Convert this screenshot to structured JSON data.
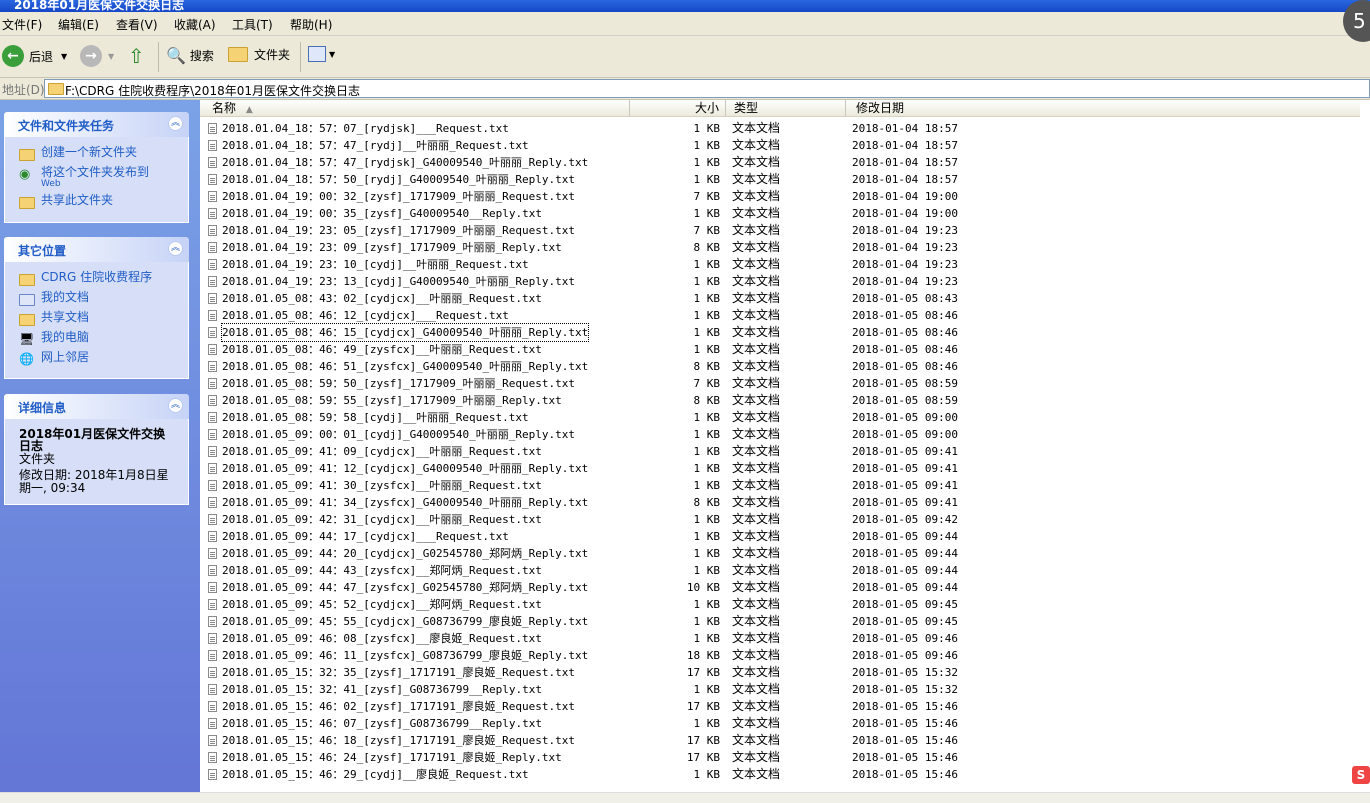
{
  "window": {
    "title": "2018年01月医保文件交换日志"
  },
  "menu": [
    "文件(F)",
    "编辑(E)",
    "查看(V)",
    "收藏(A)",
    "工具(T)",
    "帮助(H)"
  ],
  "toolbar": {
    "back": "后退",
    "search": "搜索",
    "folders": "文件夹"
  },
  "address": {
    "label": "地址(D)",
    "path": "F:\\CDRG 住院收费程序\\2018年01月医保文件交换日志"
  },
  "tasks": {
    "title": "文件和文件夹任务",
    "items": [
      "创建一个新文件夹",
      "将这个文件夹发布到",
      "Web",
      "共享此文件夹"
    ]
  },
  "places": {
    "title": "其它位置",
    "items": [
      "CDRG 住院收费程序",
      "我的文档",
      "共享文档",
      "我的电脑",
      "网上邻居"
    ]
  },
  "details": {
    "title": "详细信息",
    "name_line1": "2018年01月医保文件交换",
    "name_line2": "日志",
    "kind": "文件夹",
    "modified_line1": "修改日期: 2018年1月8日星",
    "modified_line2": "期一, 09:34"
  },
  "columns": {
    "name": "名称",
    "size": "大小",
    "type": "类型",
    "modified": "修改日期"
  },
  "files": [
    {
      "name": "2018.01.04_18：57：07_[rydjsk]___Request.txt",
      "size": "1 KB",
      "type": "文本文档",
      "date": "2018-01-04 18:57"
    },
    {
      "name": "2018.01.04_18：57：47_[rydj]__叶丽丽_Request.txt",
      "size": "1 KB",
      "type": "文本文档",
      "date": "2018-01-04 18:57"
    },
    {
      "name": "2018.01.04_18：57：47_[rydjsk]_G40009540_叶丽丽_Reply.txt",
      "size": "1 KB",
      "type": "文本文档",
      "date": "2018-01-04 18:57"
    },
    {
      "name": "2018.01.04_18：57：50_[rydj]_G40009540_叶丽丽_Reply.txt",
      "size": "1 KB",
      "type": "文本文档",
      "date": "2018-01-04 18:57"
    },
    {
      "name": "2018.01.04_19：00：32_[zysf]_1717909_叶丽丽_Request.txt",
      "size": "7 KB",
      "type": "文本文档",
      "date": "2018-01-04 19:00"
    },
    {
      "name": "2018.01.04_19：00：35_[zysf]_G40009540__Reply.txt",
      "size": "1 KB",
      "type": "文本文档",
      "date": "2018-01-04 19:00"
    },
    {
      "name": "2018.01.04_19：23：05_[zysf]_1717909_叶丽丽_Request.txt",
      "size": "7 KB",
      "type": "文本文档",
      "date": "2018-01-04 19:23"
    },
    {
      "name": "2018.01.04_19：23：09_[zysf]_1717909_叶丽丽_Reply.txt",
      "size": "8 KB",
      "type": "文本文档",
      "date": "2018-01-04 19:23"
    },
    {
      "name": "2018.01.04_19：23：10_[cydj]__叶丽丽_Request.txt",
      "size": "1 KB",
      "type": "文本文档",
      "date": "2018-01-04 19:23"
    },
    {
      "name": "2018.01.04_19：23：13_[cydj]_G40009540_叶丽丽_Reply.txt",
      "size": "1 KB",
      "type": "文本文档",
      "date": "2018-01-04 19:23"
    },
    {
      "name": "2018.01.05_08：43：02_[cydjcx]__叶丽丽_Request.txt",
      "size": "1 KB",
      "type": "文本文档",
      "date": "2018-01-05 08:43"
    },
    {
      "name": "2018.01.05_08：46：12_[cydjcx]___Request.txt",
      "size": "1 KB",
      "type": "文本文档",
      "date": "2018-01-05 08:46"
    },
    {
      "name": "2018.01.05_08：46：15_[cydjcx]_G40009540_叶丽丽_Reply.txt",
      "size": "1 KB",
      "type": "文本文档",
      "date": "2018-01-05 08:46"
    },
    {
      "name": "2018.01.05_08：46：49_[zysfcx]__叶丽丽_Request.txt",
      "size": "1 KB",
      "type": "文本文档",
      "date": "2018-01-05 08:46"
    },
    {
      "name": "2018.01.05_08：46：51_[zysfcx]_G40009540_叶丽丽_Reply.txt",
      "size": "8 KB",
      "type": "文本文档",
      "date": "2018-01-05 08:46"
    },
    {
      "name": "2018.01.05_08：59：50_[zysf]_1717909_叶丽丽_Request.txt",
      "size": "7 KB",
      "type": "文本文档",
      "date": "2018-01-05 08:59"
    },
    {
      "name": "2018.01.05_08：59：55_[zysf]_1717909_叶丽丽_Reply.txt",
      "size": "8 KB",
      "type": "文本文档",
      "date": "2018-01-05 08:59"
    },
    {
      "name": "2018.01.05_08：59：58_[cydj]__叶丽丽_Request.txt",
      "size": "1 KB",
      "type": "文本文档",
      "date": "2018-01-05 09:00"
    },
    {
      "name": "2018.01.05_09：00：01_[cydj]_G40009540_叶丽丽_Reply.txt",
      "size": "1 KB",
      "type": "文本文档",
      "date": "2018-01-05 09:00"
    },
    {
      "name": "2018.01.05_09：41：09_[cydjcx]__叶丽丽_Request.txt",
      "size": "1 KB",
      "type": "文本文档",
      "date": "2018-01-05 09:41"
    },
    {
      "name": "2018.01.05_09：41：12_[cydjcx]_G40009540_叶丽丽_Reply.txt",
      "size": "1 KB",
      "type": "文本文档",
      "date": "2018-01-05 09:41"
    },
    {
      "name": "2018.01.05_09：41：30_[zysfcx]__叶丽丽_Request.txt",
      "size": "1 KB",
      "type": "文本文档",
      "date": "2018-01-05 09:41"
    },
    {
      "name": "2018.01.05_09：41：34_[zysfcx]_G40009540_叶丽丽_Reply.txt",
      "size": "8 KB",
      "type": "文本文档",
      "date": "2018-01-05 09:41"
    },
    {
      "name": "2018.01.05_09：42：31_[cydjcx]__叶丽丽_Request.txt",
      "size": "1 KB",
      "type": "文本文档",
      "date": "2018-01-05 09:42"
    },
    {
      "name": "2018.01.05_09：44：17_[cydjcx]___Request.txt",
      "size": "1 KB",
      "type": "文本文档",
      "date": "2018-01-05 09:44"
    },
    {
      "name": "2018.01.05_09：44：20_[cydjcx]_G02545780_郑阿炳_Reply.txt",
      "size": "1 KB",
      "type": "文本文档",
      "date": "2018-01-05 09:44"
    },
    {
      "name": "2018.01.05_09：44：43_[zysfcx]__郑阿炳_Request.txt",
      "size": "1 KB",
      "type": "文本文档",
      "date": "2018-01-05 09:44"
    },
    {
      "name": "2018.01.05_09：44：47_[zysfcx]_G02545780_郑阿炳_Reply.txt",
      "size": "10 KB",
      "type": "文本文档",
      "date": "2018-01-05 09:44"
    },
    {
      "name": "2018.01.05_09：45：52_[cydjcx]__郑阿炳_Request.txt",
      "size": "1 KB",
      "type": "文本文档",
      "date": "2018-01-05 09:45"
    },
    {
      "name": "2018.01.05_09：45：55_[cydjcx]_G08736799_廖良姬_Reply.txt",
      "size": "1 KB",
      "type": "文本文档",
      "date": "2018-01-05 09:45"
    },
    {
      "name": "2018.01.05_09：46：08_[zysfcx]__廖良姬_Request.txt",
      "size": "1 KB",
      "type": "文本文档",
      "date": "2018-01-05 09:46"
    },
    {
      "name": "2018.01.05_09：46：11_[zysfcx]_G08736799_廖良姬_Reply.txt",
      "size": "18 KB",
      "type": "文本文档",
      "date": "2018-01-05 09:46"
    },
    {
      "name": "2018.01.05_15：32：35_[zysf]_1717191_廖良姬_Request.txt",
      "size": "17 KB",
      "type": "文本文档",
      "date": "2018-01-05 15:32"
    },
    {
      "name": "2018.01.05_15：32：41_[zysf]_G08736799__Reply.txt",
      "size": "1 KB",
      "type": "文本文档",
      "date": "2018-01-05 15:32"
    },
    {
      "name": "2018.01.05_15：46：02_[zysf]_1717191_廖良姬_Request.txt",
      "size": "17 KB",
      "type": "文本文档",
      "date": "2018-01-05 15:46"
    },
    {
      "name": "2018.01.05_15：46：07_[zysf]_G08736799__Reply.txt",
      "size": "1 KB",
      "type": "文本文档",
      "date": "2018-01-05 15:46"
    },
    {
      "name": "2018.01.05_15：46：18_[zysf]_1717191_廖良姬_Request.txt",
      "size": "17 KB",
      "type": "文本文档",
      "date": "2018-01-05 15:46"
    },
    {
      "name": "2018.01.05_15：46：24_[zysf]_1717191_廖良姬_Reply.txt",
      "size": "17 KB",
      "type": "文本文档",
      "date": "2018-01-05 15:46"
    },
    {
      "name": "2018.01.05_15：46：29_[cydj]__廖良姬_Request.txt",
      "size": "1 KB",
      "type": "文本文档",
      "date": "2018-01-05 15:46"
    }
  ],
  "selected_index": 12,
  "overlay_badge": "5",
  "ime_icon": "S"
}
